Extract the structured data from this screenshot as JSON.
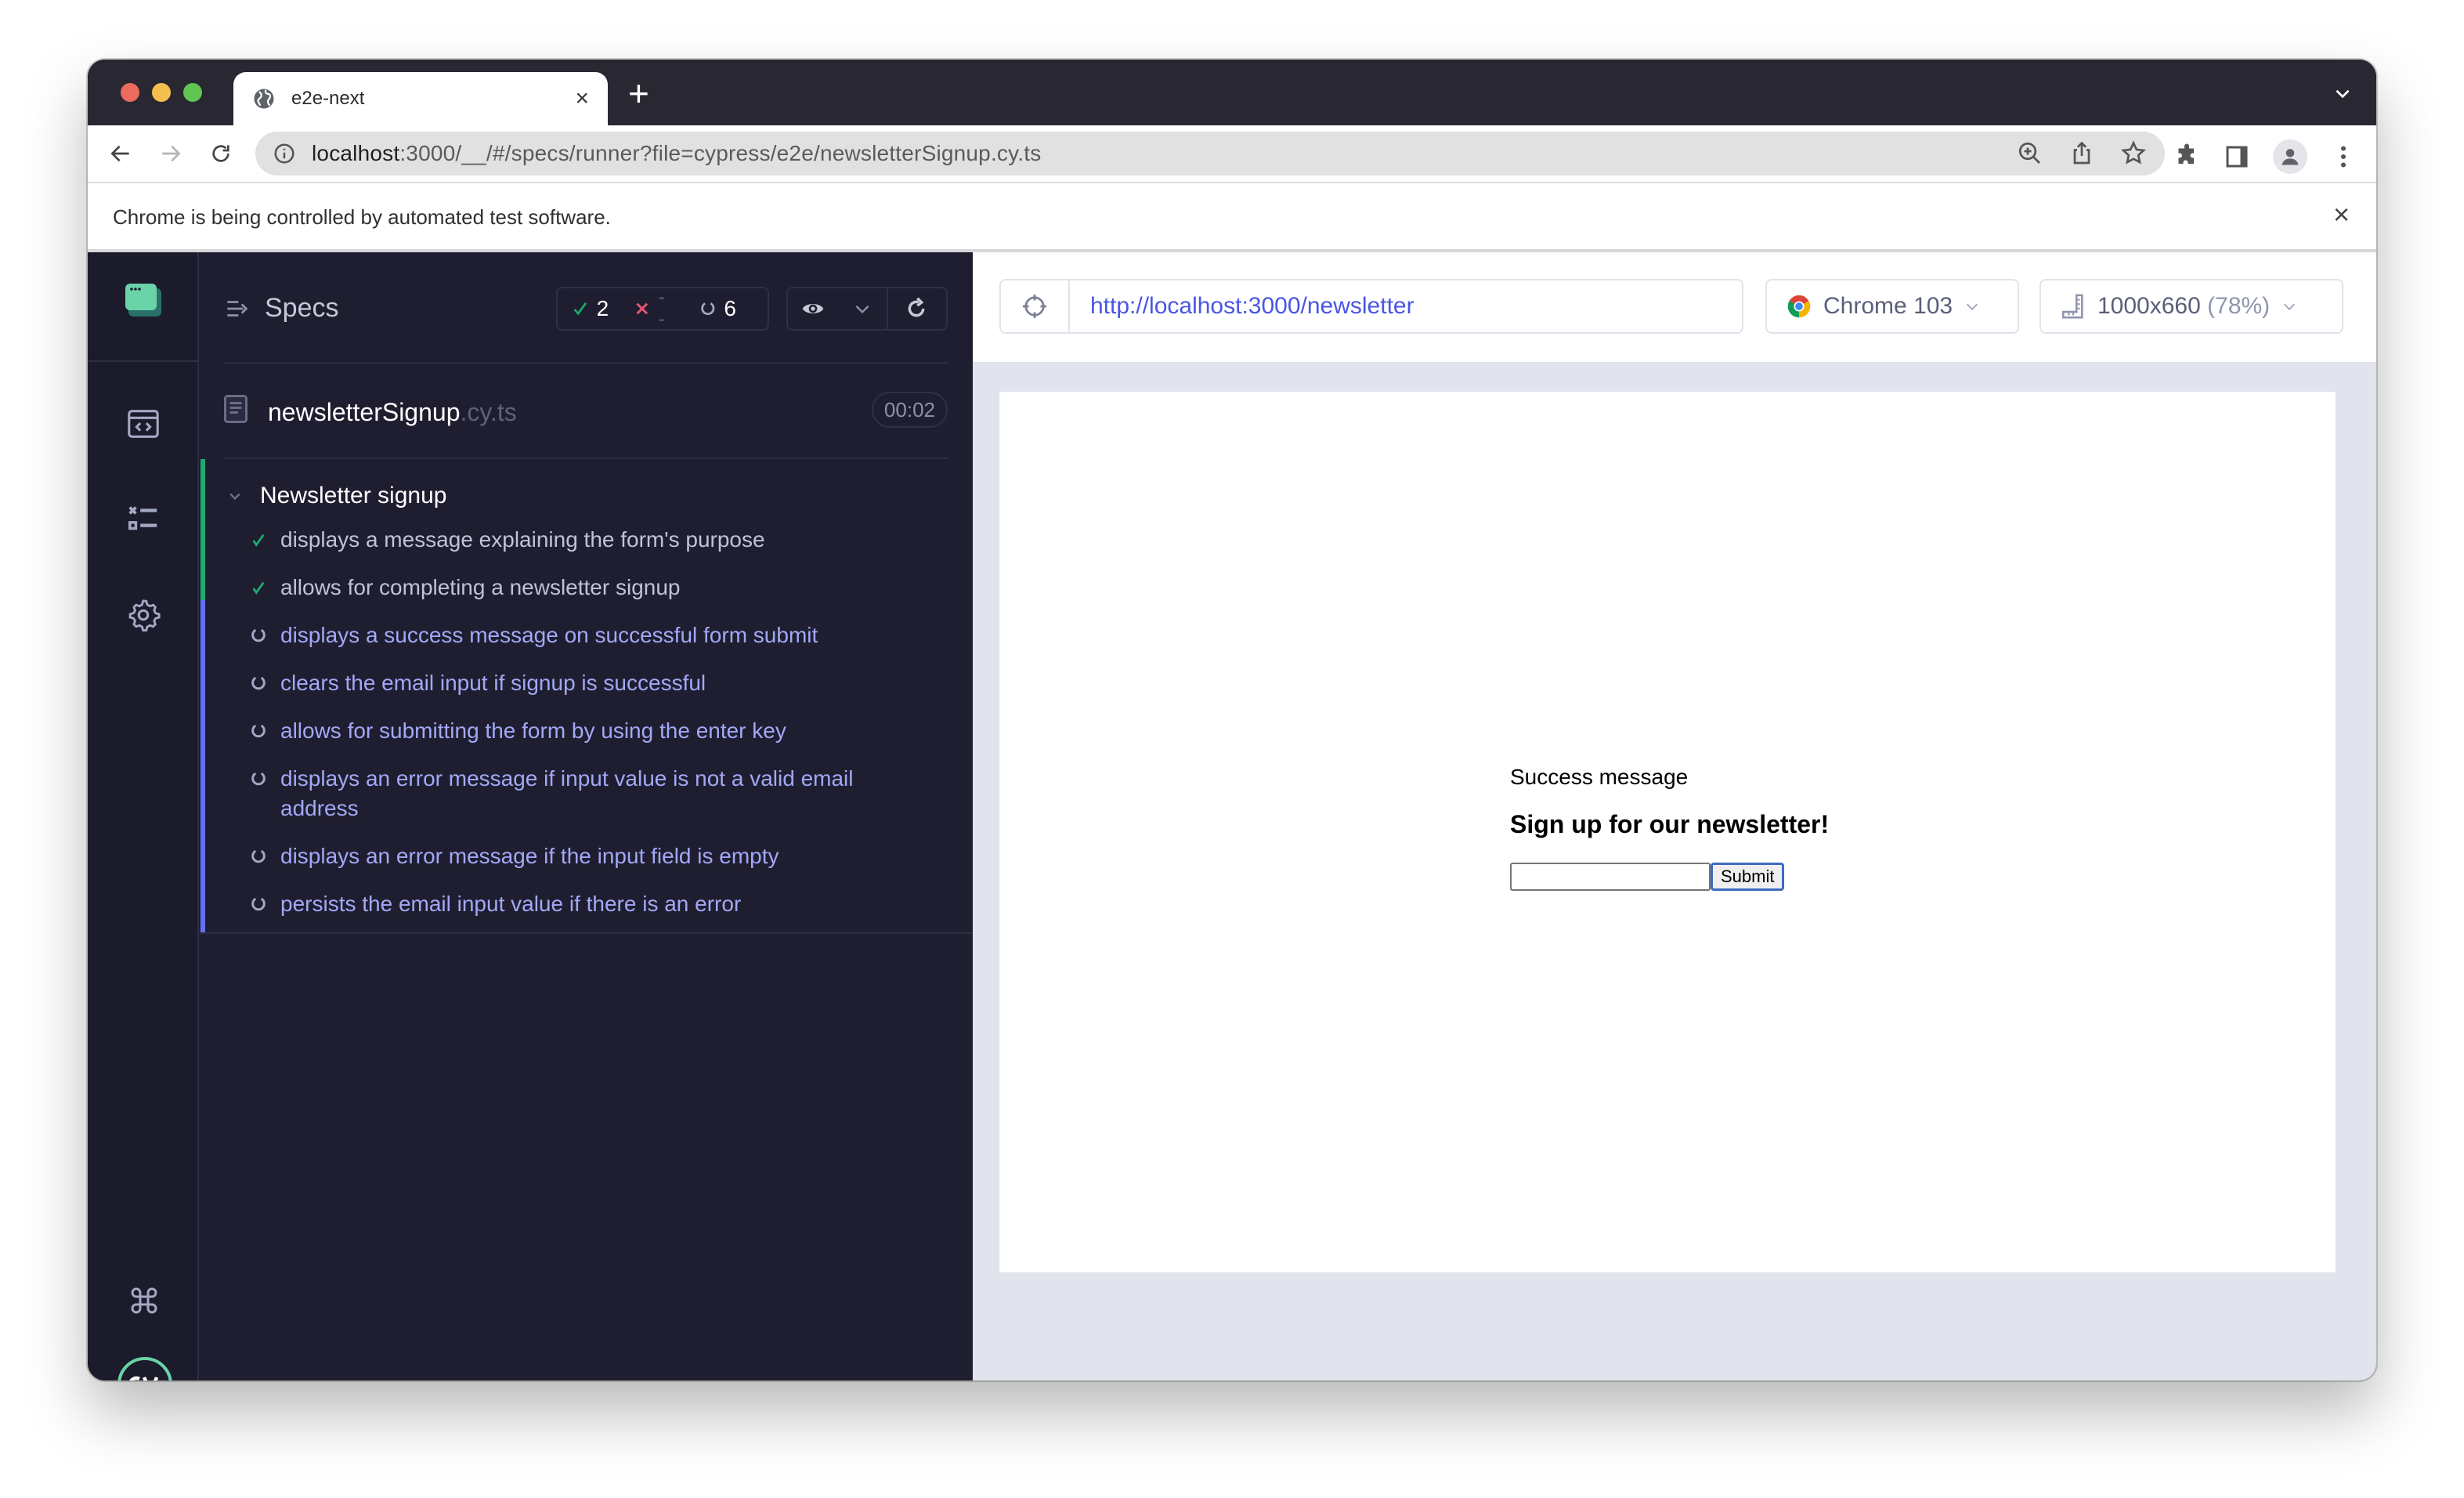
{
  "browser": {
    "tab": {
      "title": "e2e-next",
      "icon": "globe-icon",
      "close": "×"
    },
    "new_tab": "+",
    "address": {
      "host": "localhost",
      "rest": ":3000/__/#/specs/runner?file=cypress/e2e/newsletterSignup.cy.ts"
    },
    "infobar": {
      "message": "Chrome is being controlled by automated test software.",
      "close": "×"
    }
  },
  "reporter": {
    "specs_label": "Specs",
    "stats": {
      "passed": "2",
      "failed": "--",
      "pending": "6"
    },
    "spec": {
      "name": "newsletterSignup",
      "ext": ".cy.ts",
      "duration": "00:02"
    },
    "suite": {
      "title": "Newsletter signup",
      "tests": [
        {
          "state": "passed",
          "title": "displays a message explaining the form's purpose"
        },
        {
          "state": "passed",
          "title": "allows for completing a newsletter signup"
        },
        {
          "state": "pending",
          "title": "displays a success message on successful form submit"
        },
        {
          "state": "pending",
          "title": "clears the email input if signup is successful"
        },
        {
          "state": "pending",
          "title": "allows for submitting the form by using the enter key"
        },
        {
          "state": "pending",
          "title": "displays an error message if input value is not a valid email address"
        },
        {
          "state": "pending",
          "title": "displays an error message if the input field is empty"
        },
        {
          "state": "pending",
          "title": "persists the email input value if there is an error"
        }
      ]
    }
  },
  "aut": {
    "url": "http://localhost:3000/newsletter",
    "browser": "Chrome 103",
    "viewport": "1000x660",
    "scale": "(78%)",
    "page": {
      "success_message": "Success message",
      "heading": "Sign up for our newsletter!",
      "email_value": "",
      "submit_label": "Submit"
    }
  },
  "colors": {
    "passed": "#1fa971",
    "failed": "#e45770",
    "pending": "#6470f3",
    "accent_link": "#4956e3"
  }
}
